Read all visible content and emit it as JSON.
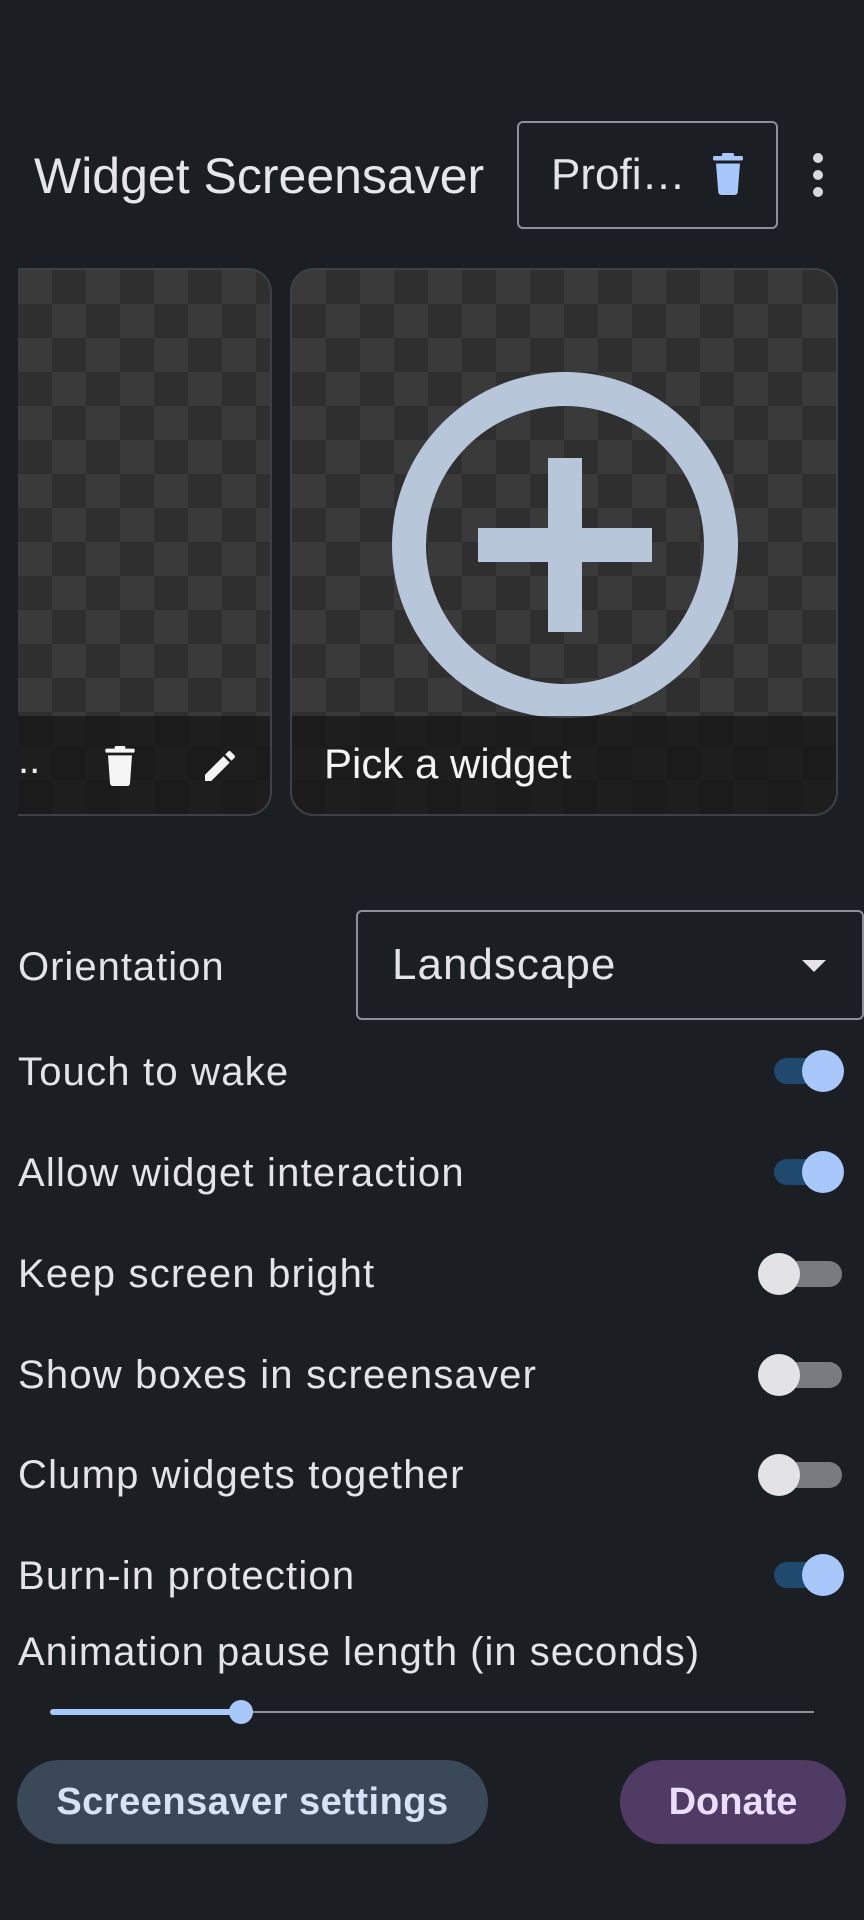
{
  "header": {
    "title": "Widget Screensaver",
    "profile_label": "Profi…",
    "icons": {
      "profile_delete": "trash-icon",
      "menu": "more-vert-icon"
    }
  },
  "widgets": {
    "left_card_label": "..",
    "left_card_icons": [
      "trash-icon",
      "pencil-icon"
    ],
    "pick_label": "Pick a widget",
    "pick_icon": "add-circle-icon"
  },
  "orientation": {
    "label": "Orientation",
    "value": "Landscape"
  },
  "settings": [
    {
      "label": "Touch to wake",
      "on": true
    },
    {
      "label": "Allow widget interaction",
      "on": true
    },
    {
      "label": "Keep screen bright",
      "on": false
    },
    {
      "label": "Show boxes in screensaver",
      "on": false
    },
    {
      "label": "Clump widgets together",
      "on": false
    },
    {
      "label": "Burn-in protection",
      "on": true
    }
  ],
  "slider": {
    "label": "Animation pause length (in seconds)",
    "value_fraction": 0.25
  },
  "buttons": {
    "screensaver_settings": "Screensaver settings",
    "donate": "Donate"
  },
  "colors": {
    "background": "#1b1e23",
    "accent": "#a8c7fa",
    "secondary_button": "#3b4858",
    "donate_button": "#4f3b63"
  }
}
